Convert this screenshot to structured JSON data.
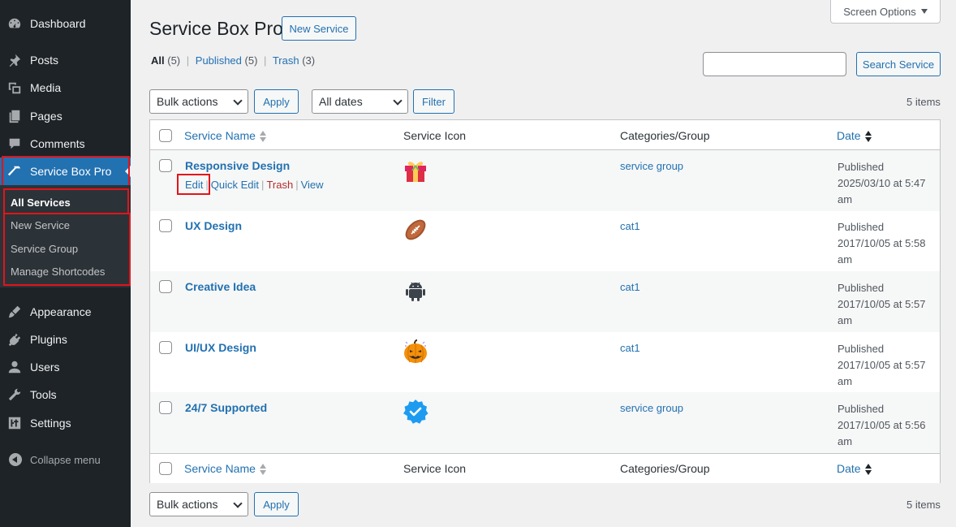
{
  "sidebar": {
    "items": [
      {
        "label": "Dashboard",
        "icon": "dashboard-icon"
      },
      {
        "label": "Posts",
        "icon": "pin-icon"
      },
      {
        "label": "Media",
        "icon": "media-icon"
      },
      {
        "label": "Pages",
        "icon": "pages-icon"
      },
      {
        "label": "Comments",
        "icon": "comment-icon"
      },
      {
        "label": "Service Box Pro",
        "icon": "hammer-icon"
      },
      {
        "label": "Appearance",
        "icon": "brush-icon"
      },
      {
        "label": "Plugins",
        "icon": "plugin-icon"
      },
      {
        "label": "Users",
        "icon": "user-icon"
      },
      {
        "label": "Tools",
        "icon": "wrench-icon"
      },
      {
        "label": "Settings",
        "icon": "settings-icon"
      }
    ],
    "submenu": [
      "All Services",
      "New Service",
      "Service Group",
      "Manage Shortcodes"
    ],
    "collapse_label": "Collapse menu"
  },
  "header": {
    "screen_options": "Screen Options",
    "title": "Service Box Pro",
    "new_button": "New Service"
  },
  "views": {
    "all": "All",
    "all_count": "(5)",
    "published": "Published",
    "published_count": "(5)",
    "trash": "Trash",
    "trash_count": "(3)",
    "sep": "|"
  },
  "search": {
    "placeholder": "",
    "button": "Search Service"
  },
  "tablenav": {
    "bulk_actions": "Bulk actions",
    "apply": "Apply",
    "dates": "All dates",
    "filter": "Filter",
    "items_count": "5 items"
  },
  "table": {
    "columns": [
      "Service Name",
      "Service Icon",
      "Categories/Group",
      "Date"
    ],
    "row_actions": {
      "edit": "Edit",
      "quick_edit": "Quick Edit",
      "trash": "Trash",
      "view": "View",
      "sep": "|"
    },
    "rows": [
      {
        "name": "Responsive Design",
        "icon": "gift-icon",
        "category": "service group",
        "status": "Published",
        "date": "2025/03/10 at 5:47",
        "ampm": "am"
      },
      {
        "name": "UX Design",
        "icon": "football-icon",
        "category": "cat1",
        "status": "Published",
        "date": "2017/10/05 at 5:58",
        "ampm": "am"
      },
      {
        "name": "Creative Idea",
        "icon": "android-icon",
        "category": "cat1",
        "status": "Published",
        "date": "2017/10/05 at 5:57",
        "ampm": "am"
      },
      {
        "name": "UI/UX Design",
        "icon": "pumpkin-icon",
        "category": "cat1",
        "status": "Published",
        "date": "2017/10/05 at 5:57",
        "ampm": "am"
      },
      {
        "name": "24/7 Supported",
        "icon": "verified-badge-icon",
        "category": "service group",
        "status": "Published",
        "date": "2017/10/05 at 5:56",
        "ampm": "am"
      }
    ]
  },
  "colors": {
    "accent": "#2271b1",
    "sidebar_bg": "#1d2327",
    "highlight": "#e2141b",
    "trash": "#b32d2e"
  }
}
